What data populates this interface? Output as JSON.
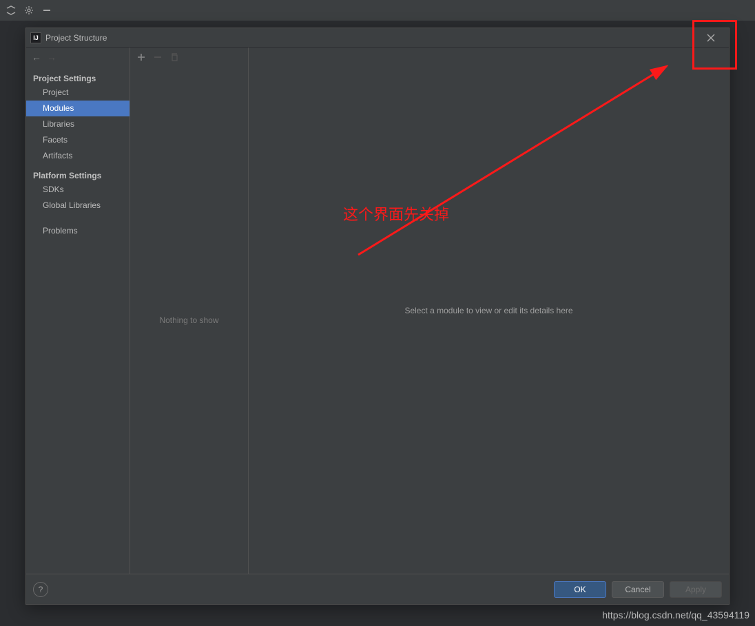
{
  "topBar": {
    "icons": [
      "collapse-icon",
      "gear-icon",
      "minus-icon"
    ]
  },
  "dialog": {
    "title": "Project Structure",
    "section_project_settings": "Project Settings",
    "items_project_settings": [
      {
        "label": "Project",
        "selected": false
      },
      {
        "label": "Modules",
        "selected": true
      },
      {
        "label": "Libraries",
        "selected": false
      },
      {
        "label": "Facets",
        "selected": false
      },
      {
        "label": "Artifacts",
        "selected": false
      }
    ],
    "section_platform_settings": "Platform Settings",
    "items_platform_settings": [
      {
        "label": "SDKs"
      },
      {
        "label": "Global Libraries"
      }
    ],
    "problems_label": "Problems",
    "middle_empty": "Nothing to show",
    "detail_placeholder": "Select a module to view or edit its details here",
    "buttons": {
      "ok": "OK",
      "cancel": "Cancel",
      "apply": "Apply"
    }
  },
  "annotation": {
    "text": "这个界面先关掉"
  },
  "watermark": "https://blog.csdn.net/qq_43594119"
}
